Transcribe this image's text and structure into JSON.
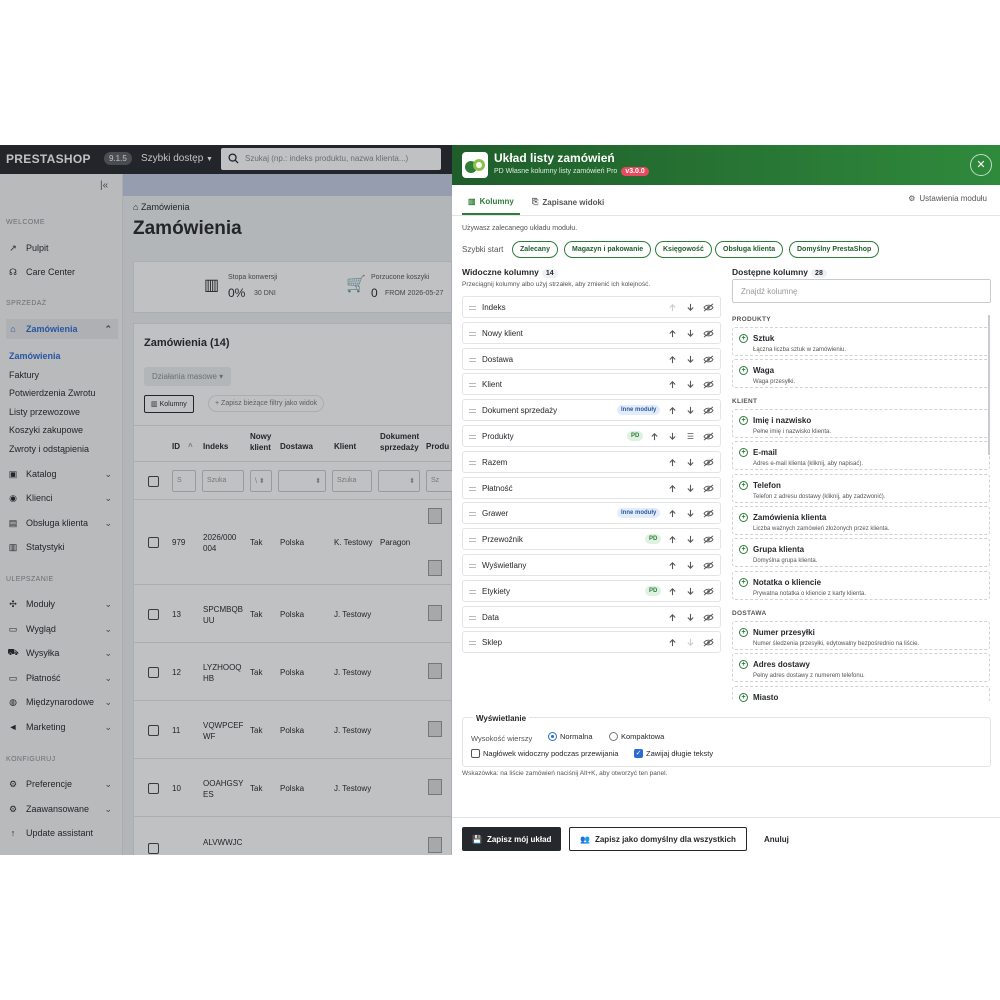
{
  "topbar": {
    "logo": "PRESTASHOP",
    "version": "9.1.5",
    "quick_access": "Szybki dostęp",
    "search_placeholder": "Szukaj (np.: indeks produktu, nazwa klienta...)"
  },
  "sidebar": {
    "sections": {
      "welcome": "WELCOME",
      "sales": "SPRZEDAŻ",
      "improve": "ULEPSZANIE",
      "configure": "KONFIGURUJ"
    },
    "items": [
      "Pulpit",
      "Care Center",
      "Zamówienia",
      "Katalog",
      "Klienci",
      "Obsługa klienta",
      "Statystyki",
      "Moduły",
      "Wygląd",
      "Wysyłka",
      "Płatność",
      "Międzynarodowe",
      "Marketing",
      "Preferencje",
      "Zaawansowane",
      "Update assistant"
    ],
    "sub": [
      "Zamówienia",
      "Faktury",
      "Potwierdzenia Zwrotu",
      "Listy przewozowe",
      "Koszyki zakupowe",
      "Zwroty i odstąpienia"
    ]
  },
  "content": {
    "breadcrumb": "Zamówienia",
    "title": "Zamówienia",
    "kpi": {
      "conv_label": "Stopa konwersji",
      "conv_value": "0%",
      "conv_sub": "30 DNI",
      "cart_label": "Porzucone koszyki",
      "cart_value": "0",
      "cart_sub": "FROM 2026-05-27"
    },
    "orders_title": "Zamówienia (14)",
    "bulk": "Działania masowe",
    "columns_btn": "Kolumny",
    "save_filters": "Zapisz bieżące filtry jako widok",
    "headers": {
      "id": "ID",
      "sort": "^",
      "index": "Indeks",
      "new": "Nowy\nklient",
      "delivery": "Dostawa",
      "client": "Klient",
      "doc": "Dokument\nsprzedaży",
      "prod": "Produ"
    },
    "filter_placeholder": "Szuka",
    "rows": [
      {
        "id": "979",
        "index": "2026/000\n004",
        "new": "Tak",
        "delivery": "Polska",
        "client": "K. Testowy",
        "doc": "Paragon"
      },
      {
        "id": "13",
        "index": "SPCMBQB\nUU",
        "new": "Tak",
        "delivery": "Polska",
        "client": "J. Testowy",
        "doc": ""
      },
      {
        "id": "12",
        "index": "LYZHOOQ\nHB",
        "new": "Tak",
        "delivery": "Polska",
        "client": "J. Testowy",
        "doc": ""
      },
      {
        "id": "11",
        "index": "VQWPCEF\nWF",
        "new": "Tak",
        "delivery": "Polska",
        "client": "J. Testowy",
        "doc": ""
      },
      {
        "id": "10",
        "index": "OOAHGSY\nES",
        "new": "Tak",
        "delivery": "Polska",
        "client": "J. Testowy",
        "doc": ""
      },
      {
        "id": "",
        "index": "ALVWWJC",
        "new": "",
        "delivery": "",
        "client": "",
        "doc": ""
      }
    ]
  },
  "modal": {
    "title": "Układ listy zamówień",
    "subtitle": "PD Własne kolumny listy zamówień Pro",
    "version": "v3.0.0",
    "tabs": [
      "Kolumny",
      "Zapisane widoki"
    ],
    "settings": "Ustawienia modułu",
    "info": "Używasz zalecanego układu modułu.",
    "quickstart_label": "Szybki start",
    "chips": [
      "Zalecany",
      "Magazyn i pakowanie",
      "Księgowość",
      "Obsługa klienta",
      "Domyślny PrestaShop"
    ],
    "visible_title": "Widoczne kolumny",
    "visible_count": "14",
    "visible_hint": "Przeciągnij kolumny albo użyj strzałek, aby zmienić ich kolejność.",
    "visible": [
      {
        "name": "Indeks",
        "badge": ""
      },
      {
        "name": "Nowy klient",
        "badge": ""
      },
      {
        "name": "Dostawa",
        "badge": ""
      },
      {
        "name": "Klient",
        "badge": ""
      },
      {
        "name": "Dokument sprzedaży",
        "badge": "Inne moduły"
      },
      {
        "name": "Produkty",
        "badge": "PD"
      },
      {
        "name": "Razem",
        "badge": ""
      },
      {
        "name": "Płatność",
        "badge": ""
      },
      {
        "name": "Grawer",
        "badge": "Inne moduły"
      },
      {
        "name": "Przewoźnik",
        "badge": "PD"
      },
      {
        "name": "Wyświetlany",
        "badge": ""
      },
      {
        "name": "Etykiety",
        "badge": "PD"
      },
      {
        "name": "Data",
        "badge": ""
      },
      {
        "name": "Sklep",
        "badge": ""
      }
    ],
    "available_title": "Dostępne kolumny",
    "available_count": "28",
    "available_search": "Znajdź kolumnę",
    "groups": {
      "products": "PRODUKTY",
      "client": "KLIENT",
      "delivery": "DOSTAWA"
    },
    "available": [
      {
        "name": "Sztuk",
        "desc": "Łączna liczba sztuk w zamówieniu."
      },
      {
        "name": "Waga",
        "desc": "Waga przesyłki."
      },
      {
        "name": "Imię i nazwisko",
        "desc": "Pełne imię i nazwisko klienta."
      },
      {
        "name": "E-mail",
        "desc": "Adres e-mail klienta (kliknij, aby napisać)."
      },
      {
        "name": "Telefon",
        "desc": "Telefon z adresu dostawy (kliknij, aby zadzwonić)."
      },
      {
        "name": "Zamówienia klienta",
        "desc": "Liczba ważnych zamówień złożonych przez klienta."
      },
      {
        "name": "Grupa klienta",
        "desc": "Domyślna grupa klienta."
      },
      {
        "name": "Notatka o kliencie",
        "desc": "Prywatna notatka o kliencie z karty klienta."
      },
      {
        "name": "Numer przesyłki",
        "desc": "Numer śledzenia przesyłki, edytowalny bezpośrednio na liście."
      },
      {
        "name": "Adres dostawy",
        "desc": "Pełny adres dostawy z numerem telefonu."
      },
      {
        "name": "Miasto",
        "desc": ""
      }
    ],
    "display": {
      "title": "Wyświetlanie",
      "row_height": "Wysokość wierszy",
      "normal": "Normalna",
      "compact": "Kompaktowa",
      "sticky": "Nagłówek widoczny podczas przewijania",
      "wrap": "Zawijaj długie teksty"
    },
    "footer_hint": "Wskazówka: na liście zamówień naciśnij Alt+K, aby otworzyć ten panel.",
    "save_mine": "Zapisz mój układ",
    "save_default": "Zapisz jako domyślny dla wszystkich",
    "cancel": "Anuluj"
  },
  "colors": {
    "accent": "#2f7d3a",
    "header_dark": "#1f5d2b",
    "version_badge": "#e84a5f",
    "topbar": "#25282c"
  }
}
